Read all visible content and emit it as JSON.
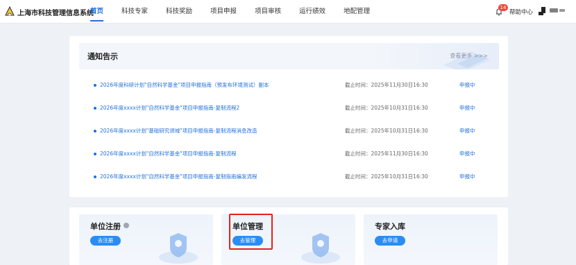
{
  "header": {
    "system_title": "上海市科技管理信息系统",
    "nav_items": [
      "首页",
      "科技专家",
      "科技奖励",
      "项目申报",
      "项目审核",
      "运行绩效",
      "地配管理"
    ],
    "active_index": 0,
    "notification_count": "14",
    "help_label": "帮助中心",
    "logo_icon": "logo-icon",
    "bell_icon": "bell-icon",
    "user_icon": "user-icon"
  },
  "notice": {
    "title": "通知告示",
    "more_label": "查看更多 >>>",
    "items": [
      {
        "title": "2026年度科研计划\"自然科学基金\"项目申报指南（预发布环境测试）副本",
        "deadline": "截止时间：2025年11月30日16:30",
        "status": "申报中"
      },
      {
        "title": "2026年度xxxx计划\"自然科学基金\"项目申报指南-复制流程2",
        "deadline": "截止时间：2025年10月31日16:30",
        "status": "申报中"
      },
      {
        "title": "2026年度xxxx计划\"基础研究领域\"项目申报指南-复制流程消息改造",
        "deadline": "截止时间：2025年10月31日16:30",
        "status": "申报中"
      },
      {
        "title": "2026年度xxxx计划\"自然科学基金\"项目申报指南-复制流程",
        "deadline": "截止时间：2025年11月30日16:30",
        "status": "申报中"
      },
      {
        "title": "2026年度xxxx计划\"自然科学基金\"项目申报指南-复制指南编发流程",
        "deadline": "截止时间：2025年10月31日16:30",
        "status": "申报中"
      }
    ]
  },
  "cards": [
    {
      "title": "单位注册",
      "button": "去注册",
      "has_info_icon": true
    },
    {
      "title": "单位管理",
      "button": "去管理",
      "has_info_icon": false
    },
    {
      "title": "专家入库",
      "button": "去申请",
      "has_info_icon": false
    }
  ],
  "colors": {
    "accent": "#1f6fdb",
    "button": "#2a8df5",
    "badge": "#f2463f",
    "highlight": "#e2211c"
  }
}
